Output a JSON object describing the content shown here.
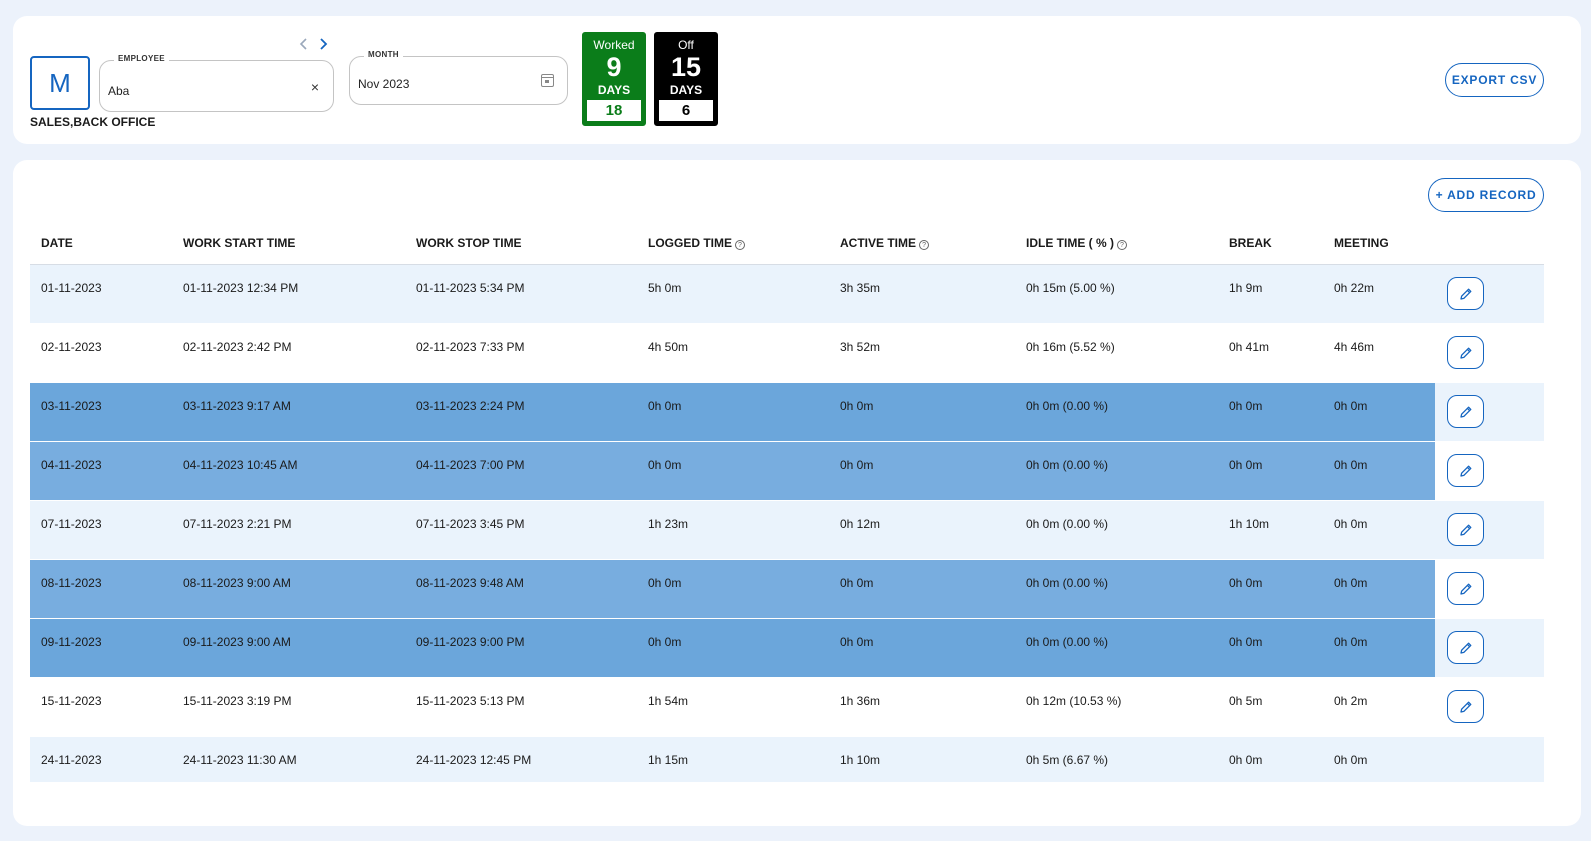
{
  "employee_card": {
    "avatar_letter": "M",
    "department": "SALES,BACK OFFICE",
    "employee_label": "EMPLOYEE",
    "employee_value": "Aba",
    "clear_symbol": "×",
    "month_label": "MONTH",
    "month_value": "Nov 2023",
    "icons": [
      "chevron-left-icon",
      "chevron-right-icon",
      "close-icon",
      "calendar-icon"
    ]
  },
  "stats": {
    "worked": {
      "title": "Worked",
      "value": "9",
      "unit": "DAYS",
      "sub": "18",
      "color": "#0b7d1a"
    },
    "off": {
      "title": "Off",
      "value": "15",
      "unit": "DAYS",
      "sub": "6",
      "color": "#000000"
    }
  },
  "actions": {
    "export_label": "EXPORT CSV",
    "add_record_label": "+ ADD RECORD"
  },
  "table": {
    "help_symbol": "?",
    "columns": [
      "DATE",
      "WORK START TIME",
      "WORK STOP TIME",
      "LOGGED TIME",
      "ACTIVE TIME",
      "IDLE TIME ( % )",
      "BREAK",
      "MEETING"
    ],
    "colors": {
      "light": "#eaf3fc",
      "white": "#ffffff",
      "dark": "#6ba6db",
      "mid": "#78addf"
    },
    "rows": [
      {
        "cells": [
          "01-11-2023",
          "01-11-2023 12:34 PM",
          "01-11-2023 5:34 PM",
          "5h 0m",
          "3h 35m",
          "0h 15m (5.00 %)",
          "1h 9m",
          "0h 22m"
        ],
        "style": "light",
        "editable": true
      },
      {
        "cells": [
          "02-11-2023",
          "02-11-2023 2:42 PM",
          "02-11-2023 7:33 PM",
          "4h 50m",
          "3h 52m",
          "0h 16m (5.52 %)",
          "0h 41m",
          "4h 46m"
        ],
        "style": "white",
        "editable": true
      },
      {
        "cells": [
          "03-11-2023",
          "03-11-2023 9:17 AM",
          "03-11-2023 2:24 PM",
          "0h 0m",
          "0h 0m",
          "0h 0m (0.00 %)",
          "0h 0m",
          "0h 0m"
        ],
        "style": "dark",
        "editable": true
      },
      {
        "cells": [
          "04-11-2023",
          "04-11-2023 10:45 AM",
          "04-11-2023 7:00 PM",
          "0h 0m",
          "0h 0m",
          "0h 0m (0.00 %)",
          "0h 0m",
          "0h 0m"
        ],
        "style": "mid",
        "editable": true
      },
      {
        "cells": [
          "07-11-2023",
          "07-11-2023 2:21 PM",
          "07-11-2023 3:45 PM",
          "1h 23m",
          "0h 12m",
          "0h 0m (0.00 %)",
          "1h 10m",
          "0h 0m"
        ],
        "style": "light",
        "editable": true
      },
      {
        "cells": [
          "08-11-2023",
          "08-11-2023 9:00 AM",
          "08-11-2023 9:48 AM",
          "0h 0m",
          "0h 0m",
          "0h 0m (0.00 %)",
          "0h 0m",
          "0h 0m"
        ],
        "style": "mid",
        "editable": true
      },
      {
        "cells": [
          "09-11-2023",
          "09-11-2023 9:00 AM",
          "09-11-2023 9:00 PM",
          "0h 0m",
          "0h 0m",
          "0h 0m (0.00 %)",
          "0h 0m",
          "0h 0m"
        ],
        "style": "dark",
        "editable": true
      },
      {
        "cells": [
          "15-11-2023",
          "15-11-2023 3:19 PM",
          "15-11-2023 5:13 PM",
          "1h 54m",
          "1h 36m",
          "0h 12m (10.53 %)",
          "0h 5m",
          "0h 2m"
        ],
        "style": "white",
        "editable": true
      },
      {
        "cells": [
          "24-11-2023",
          "24-11-2023 11:30 AM",
          "24-11-2023 12:45 PM",
          "1h 15m",
          "1h 10m",
          "0h 5m (6.67 %)",
          "0h 0m",
          "0h 0m"
        ],
        "style": "light",
        "editable": false
      }
    ]
  }
}
